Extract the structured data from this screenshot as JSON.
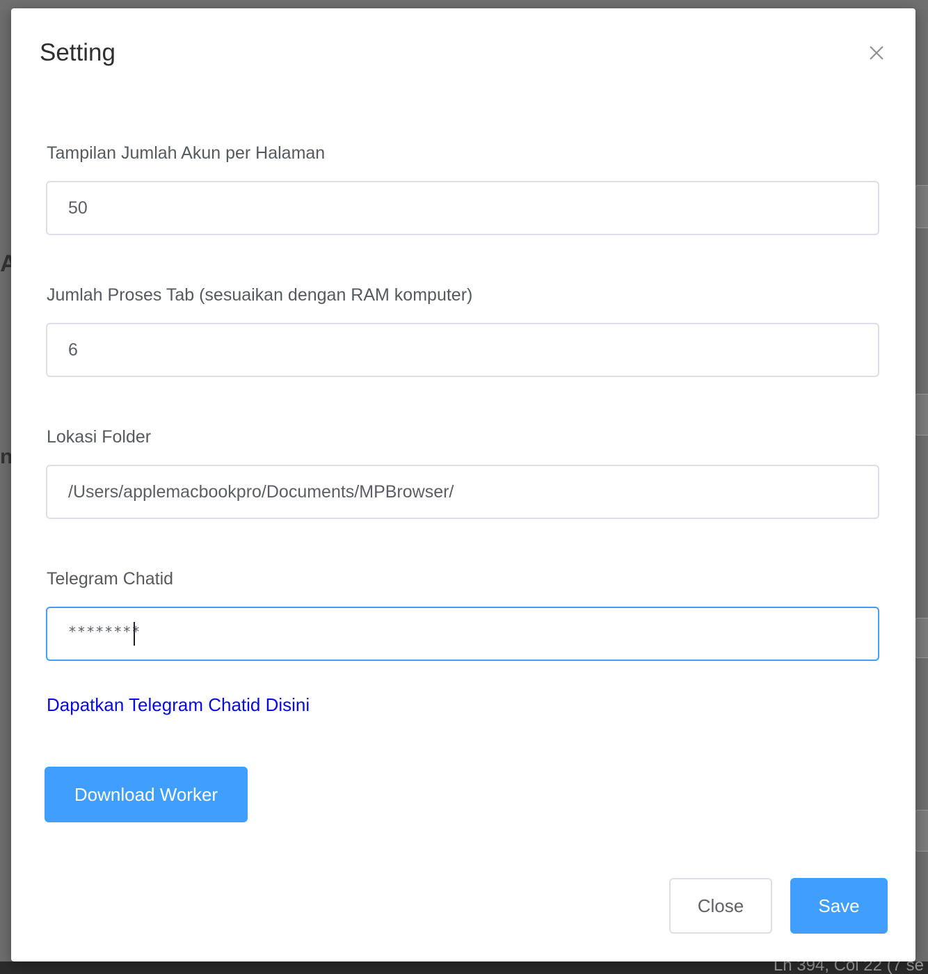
{
  "modal": {
    "title": "Setting",
    "fields": [
      {
        "label": "Tampilan Jumlah Akun per Halaman",
        "value": "50"
      },
      {
        "label": "Jumlah Proses Tab (sesuaikan dengan RAM komputer)",
        "value": "6"
      },
      {
        "label": "Lokasi Folder",
        "value": "/Users/applemacbookpro/Documents/MPBrowser/"
      },
      {
        "label": "Telegram Chatid",
        "masked_value": "********"
      }
    ],
    "telegram_link": "Dapatkan Telegram Chatid Disini",
    "download_button": "Download Worker",
    "close_button": "Close",
    "save_button": "Save"
  },
  "background": {
    "status_text": "Ln 394, Col 22 (7 se",
    "fragment_a": "A",
    "fragment_na": "na"
  },
  "colors": {
    "primary": "#409eff",
    "link": "#0a0adb",
    "focus_border": "#409eff",
    "input_border": "#dcdfe6"
  },
  "icons": {
    "close": "close-icon"
  }
}
